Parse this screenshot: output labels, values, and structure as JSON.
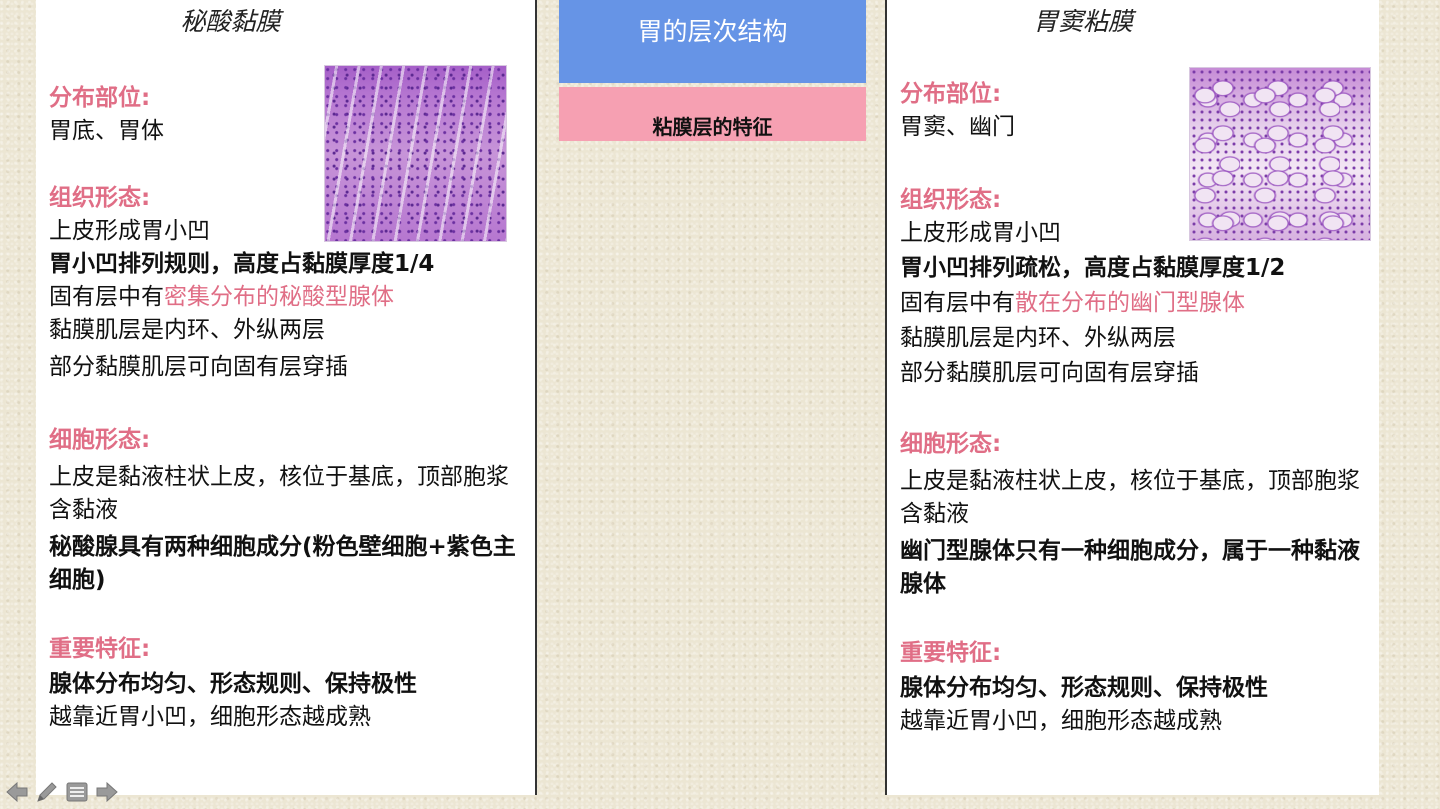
{
  "left": {
    "title": "秘酸黏膜",
    "dist_hdr": "分布部位:",
    "dist": "胃底、胃体",
    "tissue_hdr": "组织形态:",
    "t1": "上皮形成胃小凹",
    "t2": "胃小凹排列规则，高度占黏膜厚度1/4",
    "t3a": "固有层中有",
    "t3b": "密集分布的秘酸型腺体",
    "t4": "黏膜肌层是内环、外纵两层",
    "t5": "部分黏膜肌层可向固有层穿插",
    "cell_hdr": "细胞形态:",
    "c1": "上皮是黏液柱状上皮，核位于基底，顶部胞浆含黏液",
    "c2": "秘酸腺具有两种细胞成分(粉色壁细胞+紫色主细胞)",
    "key_hdr": "重要特征:",
    "k1": "腺体分布均匀、形态规则、保持极性",
    "k2": "越靠近胃小凹，细胞形态越成熟"
  },
  "center": {
    "title": "胃的层次结构",
    "subtitle": "粘膜层的特征"
  },
  "right": {
    "title": "胃窦粘膜",
    "dist_hdr": "分布部位:",
    "dist": "胃窦、幽门",
    "tissue_hdr": "组织形态:",
    "t1": "上皮形成胃小凹",
    "t2": "胃小凹排列疏松，高度占黏膜厚度1/2",
    "t3a": "固有层中有",
    "t3b": "散在分布的幽门型腺体",
    "t4": "黏膜肌层是内环、外纵两层",
    "t5": "部分黏膜肌层可向固有层穿插",
    "cell_hdr": "细胞形态:",
    "c1": "上皮是黏液柱状上皮，核位于基底，顶部胞浆含黏液",
    "c2": "幽门型腺体只有一种细胞成分，属于一种黏液腺体",
    "key_hdr": "重要特征:",
    "k1": "腺体分布均匀、形态规则、保持极性",
    "k2": "越靠近胃小凹，细胞形态越成熟"
  },
  "nav": {
    "icons": [
      "arrow-left-icon",
      "pen-icon",
      "menu-icon",
      "arrow-right-icon"
    ]
  }
}
